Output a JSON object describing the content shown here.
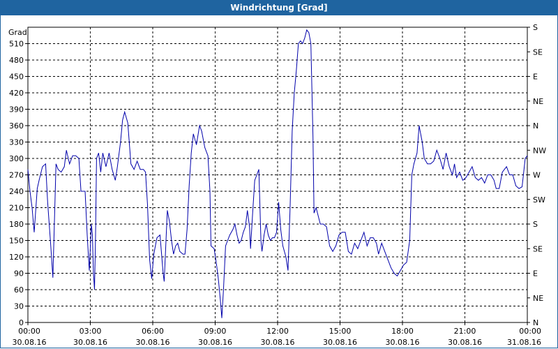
{
  "chart_data": {
    "type": "line",
    "title": "Windrichtung [Grad]",
    "ylabel": "Grad",
    "ylim": [
      0,
      540
    ],
    "yticks": [
      0,
      30,
      60,
      90,
      120,
      150,
      180,
      210,
      240,
      270,
      300,
      330,
      360,
      390,
      420,
      450,
      480,
      510
    ],
    "right_axis": {
      "labels": [
        {
          "value": 0,
          "label": "N"
        },
        {
          "value": 45,
          "label": "NE"
        },
        {
          "value": 90,
          "label": "E"
        },
        {
          "value": 135,
          "label": "SE"
        },
        {
          "value": 180,
          "label": "S"
        },
        {
          "value": 225,
          "label": "SW"
        },
        {
          "value": 270,
          "label": "W"
        },
        {
          "value": 315,
          "label": "NW"
        },
        {
          "value": 360,
          "label": "N"
        },
        {
          "value": 405,
          "label": "NE"
        },
        {
          "value": 450,
          "label": "E"
        },
        {
          "value": 495,
          "label": "SE"
        },
        {
          "value": 540,
          "label": "S"
        }
      ]
    },
    "xlim_hours": [
      0,
      24
    ],
    "xticks": [
      {
        "hour": 0,
        "time": "00:00",
        "date": "30.08.16"
      },
      {
        "hour": 3,
        "time": "03:00",
        "date": "30.08.16"
      },
      {
        "hour": 6,
        "time": "06:00",
        "date": "30.08.16"
      },
      {
        "hour": 9,
        "time": "09:00",
        "date": "30.08.16"
      },
      {
        "hour": 12,
        "time": "12:00",
        "date": "30.08.16"
      },
      {
        "hour": 15,
        "time": "15:00",
        "date": "30.08.16"
      },
      {
        "hour": 18,
        "time": "18:00",
        "date": "30.08.16"
      },
      {
        "hour": 21,
        "time": "21:00",
        "date": "30.08.16"
      },
      {
        "hour": 24,
        "time": "00:00",
        "date": "31.08.16"
      }
    ],
    "grid": true,
    "series": [
      {
        "color": "#0000aa",
        "points": [
          [
            0.0,
            280
          ],
          [
            0.1,
            240
          ],
          [
            0.2,
            210
          ],
          [
            0.3,
            165
          ],
          [
            0.45,
            245
          ],
          [
            0.55,
            262
          ],
          [
            0.7,
            285
          ],
          [
            0.85,
            290
          ],
          [
            0.95,
            220
          ],
          [
            1.1,
            140
          ],
          [
            1.2,
            82
          ],
          [
            1.35,
            290
          ],
          [
            1.45,
            280
          ],
          [
            1.6,
            275
          ],
          [
            1.75,
            285
          ],
          [
            1.85,
            315
          ],
          [
            2.0,
            290
          ],
          [
            2.15,
            305
          ],
          [
            2.3,
            305
          ],
          [
            2.45,
            300
          ],
          [
            2.55,
            240
          ],
          [
            2.75,
            240
          ],
          [
            2.85,
            160
          ],
          [
            2.95,
            95
          ],
          [
            3.05,
            180
          ],
          [
            3.1,
            160
          ],
          [
            3.15,
            90
          ],
          [
            3.2,
            60
          ],
          [
            3.25,
            160
          ],
          [
            3.3,
            300
          ],
          [
            3.4,
            310
          ],
          [
            3.5,
            275
          ],
          [
            3.6,
            310
          ],
          [
            3.75,
            285
          ],
          [
            3.9,
            310
          ],
          [
            4.05,
            280
          ],
          [
            4.2,
            260
          ],
          [
            4.3,
            285
          ],
          [
            4.45,
            330
          ],
          [
            4.55,
            370
          ],
          [
            4.65,
            385
          ],
          [
            4.8,
            365
          ],
          [
            4.95,
            290
          ],
          [
            5.1,
            280
          ],
          [
            5.25,
            295
          ],
          [
            5.4,
            280
          ],
          [
            5.55,
            280
          ],
          [
            5.65,
            275
          ],
          [
            5.75,
            215
          ],
          [
            5.85,
            115
          ],
          [
            5.95,
            80
          ],
          [
            6.05,
            125
          ],
          [
            6.2,
            155
          ],
          [
            6.35,
            160
          ],
          [
            6.5,
            90
          ],
          [
            6.55,
            75
          ],
          [
            6.7,
            205
          ],
          [
            6.8,
            185
          ],
          [
            6.9,
            150
          ],
          [
            7.0,
            125
          ],
          [
            7.1,
            140
          ],
          [
            7.2,
            145
          ],
          [
            7.3,
            130
          ],
          [
            7.45,
            125
          ],
          [
            7.55,
            125
          ],
          [
            7.65,
            170
          ],
          [
            7.75,
            250
          ],
          [
            7.85,
            310
          ],
          [
            7.95,
            345
          ],
          [
            8.1,
            325
          ],
          [
            8.25,
            360
          ],
          [
            8.35,
            350
          ],
          [
            8.5,
            320
          ],
          [
            8.6,
            310
          ],
          [
            8.65,
            305
          ],
          [
            8.75,
            240
          ],
          [
            8.8,
            140
          ],
          [
            8.95,
            135
          ],
          [
            9.05,
            110
          ],
          [
            9.15,
            80
          ],
          [
            9.25,
            40
          ],
          [
            9.32,
            8
          ],
          [
            9.4,
            60
          ],
          [
            9.5,
            140
          ],
          [
            9.6,
            150
          ],
          [
            9.7,
            160
          ],
          [
            9.85,
            170
          ],
          [
            9.95,
            180
          ],
          [
            10.05,
            160
          ],
          [
            10.15,
            145
          ],
          [
            10.25,
            150
          ],
          [
            10.35,
            165
          ],
          [
            10.45,
            175
          ],
          [
            10.55,
            205
          ],
          [
            10.65,
            175
          ],
          [
            10.7,
            135
          ],
          [
            10.8,
            200
          ],
          [
            10.9,
            260
          ],
          [
            11.0,
            270
          ],
          [
            11.1,
            280
          ],
          [
            11.2,
            150
          ],
          [
            11.25,
            130
          ],
          [
            11.35,
            160
          ],
          [
            11.45,
            180
          ],
          [
            11.55,
            160
          ],
          [
            11.65,
            150
          ],
          [
            11.75,
            155
          ],
          [
            11.85,
            155
          ],
          [
            11.95,
            165
          ],
          [
            12.05,
            220
          ],
          [
            12.15,
            170
          ],
          [
            12.25,
            140
          ],
          [
            12.4,
            120
          ],
          [
            12.5,
            95
          ],
          [
            12.6,
            210
          ],
          [
            12.7,
            350
          ],
          [
            12.8,
            420
          ],
          [
            12.9,
            460
          ],
          [
            13.0,
            510
          ],
          [
            13.1,
            515
          ],
          [
            13.2,
            510
          ],
          [
            13.3,
            520
          ],
          [
            13.4,
            535
          ],
          [
            13.5,
            530
          ],
          [
            13.6,
            510
          ],
          [
            13.7,
            340
          ],
          [
            13.75,
            200
          ],
          [
            13.85,
            210
          ],
          [
            13.95,
            195
          ],
          [
            14.05,
            180
          ],
          [
            14.2,
            180
          ],
          [
            14.35,
            175
          ],
          [
            14.5,
            140
          ],
          [
            14.65,
            130
          ],
          [
            14.8,
            140
          ],
          [
            14.95,
            160
          ],
          [
            15.1,
            165
          ],
          [
            15.25,
            165
          ],
          [
            15.4,
            130
          ],
          [
            15.55,
            125
          ],
          [
            15.7,
            145
          ],
          [
            15.85,
            135
          ],
          [
            16.0,
            150
          ],
          [
            16.15,
            165
          ],
          [
            16.3,
            140
          ],
          [
            16.45,
            155
          ],
          [
            16.6,
            155
          ],
          [
            16.75,
            145
          ],
          [
            16.85,
            125
          ],
          [
            17.0,
            145
          ],
          [
            17.15,
            130
          ],
          [
            17.3,
            115
          ],
          [
            17.45,
            100
          ],
          [
            17.6,
            90
          ],
          [
            17.75,
            85
          ],
          [
            17.9,
            95
          ],
          [
            18.05,
            105
          ],
          [
            18.2,
            110
          ],
          [
            18.35,
            150
          ],
          [
            18.45,
            270
          ],
          [
            18.55,
            290
          ],
          [
            18.7,
            310
          ],
          [
            18.8,
            360
          ],
          [
            18.95,
            330
          ],
          [
            19.05,
            300
          ],
          [
            19.2,
            290
          ],
          [
            19.35,
            290
          ],
          [
            19.5,
            295
          ],
          [
            19.65,
            315
          ],
          [
            19.8,
            300
          ],
          [
            19.95,
            280
          ],
          [
            20.1,
            310
          ],
          [
            20.25,
            285
          ],
          [
            20.4,
            270
          ],
          [
            20.5,
            290
          ],
          [
            20.6,
            265
          ],
          [
            20.75,
            275
          ],
          [
            20.9,
            260
          ],
          [
            21.05,
            265
          ],
          [
            21.2,
            275
          ],
          [
            21.35,
            285
          ],
          [
            21.5,
            265
          ],
          [
            21.65,
            260
          ],
          [
            21.8,
            265
          ],
          [
            21.95,
            255
          ],
          [
            22.1,
            270
          ],
          [
            22.25,
            270
          ],
          [
            22.4,
            260
          ],
          [
            22.5,
            245
          ],
          [
            22.65,
            245
          ],
          [
            22.8,
            275
          ],
          [
            23.0,
            285
          ],
          [
            23.15,
            270
          ],
          [
            23.3,
            270
          ],
          [
            23.45,
            250
          ],
          [
            23.6,
            245
          ],
          [
            23.75,
            248
          ],
          [
            23.9,
            300
          ],
          [
            24.0,
            305
          ]
        ]
      }
    ]
  }
}
